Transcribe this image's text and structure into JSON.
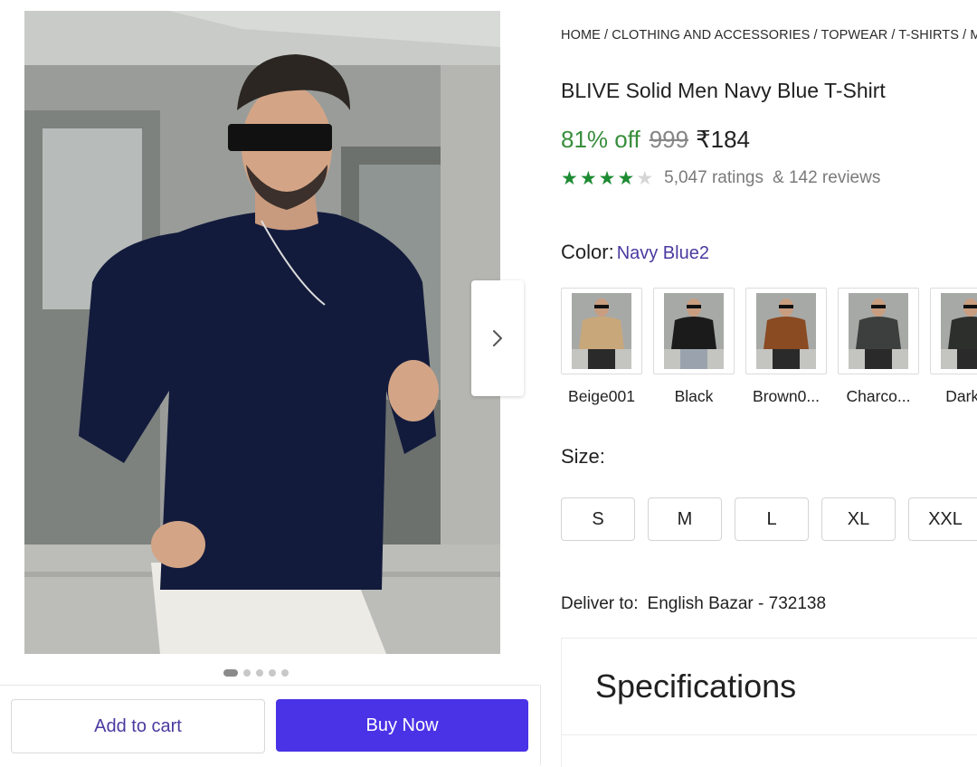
{
  "breadcrumb": "HOME / CLOTHING AND ACCESSORIES / TOPWEAR / T-SHIRTS / M",
  "product": {
    "title": "BLIVE Solid Men Navy Blue T-Shirt",
    "discount": "81% off",
    "mrp": "999",
    "price": "₹184",
    "rating_value": 4,
    "rating_max": 5,
    "ratings_text": "5,047 ratings",
    "reviews_text": "& 142 reviews"
  },
  "color": {
    "label": "Color:",
    "selected": "Navy Blue2",
    "options": [
      {
        "label": "Beige001",
        "color": "#c8a77a"
      },
      {
        "label": "Black",
        "color": "#1b1b1b"
      },
      {
        "label": "Brown0...",
        "color": "#8a4a22"
      },
      {
        "label": "Charco...",
        "color": "#3d3f3e"
      },
      {
        "label": "Dark G",
        "color": "#2c2f2c"
      }
    ]
  },
  "size": {
    "label": "Size:",
    "options": [
      "S",
      "M",
      "L",
      "XL",
      "XXL"
    ]
  },
  "delivery": {
    "label": "Deliver to:",
    "location": "English Bazar - 732138"
  },
  "specifications": {
    "title": "Specifications"
  },
  "actions": {
    "add_to_cart": "Add to cart",
    "buy_now": "Buy Now"
  },
  "gallery": {
    "image_count": 5,
    "active_index": 0,
    "next_icon": "chevron-right-icon"
  },
  "colors": {
    "accent": "#4a32e6",
    "discount_green": "#388e3c",
    "star_green": "#1d8b32",
    "link_purple": "#4a3aa0"
  }
}
